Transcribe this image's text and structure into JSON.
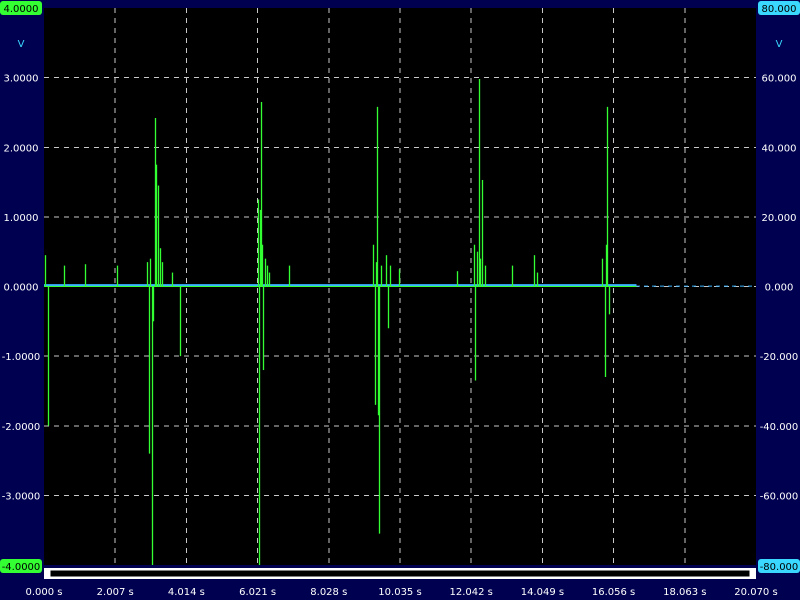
{
  "colors": {
    "background": "#000050",
    "plot_background": "#000000",
    "grid": "#c8c8c8",
    "channel_a": "#33ff33",
    "channel_b": "#3ab4ff",
    "badge_a": "#33ff33",
    "badge_b": "#3ad8ff"
  },
  "chart_data": {
    "type": "line",
    "grid": true,
    "left_axis": {
      "unit": "V",
      "ylim": [
        -4,
        4
      ],
      "top_label": "4.0000",
      "bottom_label": "-4.0000",
      "ticks": [
        "3.0000",
        "2.0000",
        "1.0000",
        "0.0000",
        "-1.0000",
        "-2.0000",
        "-3.0000"
      ],
      "tick_values": [
        3,
        2,
        1,
        0,
        -1,
        -2,
        -3
      ]
    },
    "right_axis": {
      "unit": "V",
      "ylim": [
        -80,
        80
      ],
      "top_label": "80.000",
      "bottom_label": "-80.000",
      "ticks": [
        "60.000",
        "40.000",
        "20.000",
        "0.000",
        "-20.000",
        "-40.000",
        "-60.000"
      ],
      "tick_values": [
        60,
        40,
        20,
        0,
        -20,
        -40,
        -60
      ]
    },
    "x_axis": {
      "xlim": [
        0,
        20.07
      ],
      "ticks": [
        "0.000 s",
        "2.007 s",
        "4.014 s",
        "6.021 s",
        "8.028 s",
        "10.035 s",
        "12.042 s",
        "14.049 s",
        "16.056 s",
        "18.063 s",
        "20.070 s"
      ],
      "tick_values": [
        0,
        2.007,
        4.014,
        6.021,
        8.028,
        10.035,
        12.042,
        14.049,
        16.056,
        18.063,
        20.07
      ]
    },
    "series": [
      {
        "axis": "left",
        "spikes": [
          {
            "t": 0.03,
            "v": 0.45
          },
          {
            "t": 0.1,
            "v": -2.0
          },
          {
            "t": 0.55,
            "v": 0.3
          },
          {
            "t": 1.15,
            "v": 0.32
          },
          {
            "t": 2.07,
            "v": 0.3
          },
          {
            "t": 2.9,
            "v": 0.35
          },
          {
            "t": 2.96,
            "v": -2.4
          },
          {
            "t": 3.0,
            "v": 0.4
          },
          {
            "t": 3.05,
            "v": -4.0
          },
          {
            "t": 3.08,
            "v": -0.5
          },
          {
            "t": 3.12,
            "v": 2.42
          },
          {
            "t": 3.16,
            "v": 1.75
          },
          {
            "t": 3.2,
            "v": 1.45
          },
          {
            "t": 3.26,
            "v": 0.55
          },
          {
            "t": 3.32,
            "v": 0.35
          },
          {
            "t": 3.6,
            "v": 0.2
          },
          {
            "t": 3.82,
            "v": -1.0
          },
          {
            "t": 6.02,
            "v": 1.25
          },
          {
            "t": 6.05,
            "v": -4.0
          },
          {
            "t": 6.08,
            "v": 1.1
          },
          {
            "t": 6.12,
            "v": 2.65
          },
          {
            "t": 6.15,
            "v": 0.6
          },
          {
            "t": 6.18,
            "v": -1.2
          },
          {
            "t": 6.22,
            "v": 0.4
          },
          {
            "t": 6.28,
            "v": 0.3
          },
          {
            "t": 6.35,
            "v": 0.2
          },
          {
            "t": 6.9,
            "v": 0.3
          },
          {
            "t": 9.28,
            "v": 0.6
          },
          {
            "t": 9.33,
            "v": -1.7
          },
          {
            "t": 9.36,
            "v": 0.35
          },
          {
            "t": 9.39,
            "v": 2.58
          },
          {
            "t": 9.42,
            "v": -1.85
          },
          {
            "t": 9.45,
            "v": -3.55
          },
          {
            "t": 9.5,
            "v": 0.3
          },
          {
            "t": 9.64,
            "v": 0.45
          },
          {
            "t": 9.7,
            "v": -0.6
          },
          {
            "t": 9.76,
            "v": 0.3
          },
          {
            "t": 10.0,
            "v": 0.25
          },
          {
            "t": 11.64,
            "v": 0.22
          },
          {
            "t": 12.12,
            "v": 0.6
          },
          {
            "t": 12.16,
            "v": -1.35
          },
          {
            "t": 12.2,
            "v": 0.5
          },
          {
            "t": 12.25,
            "v": 2.98
          },
          {
            "t": 12.3,
            "v": 0.4
          },
          {
            "t": 12.36,
            "v": 1.53
          },
          {
            "t": 12.42,
            "v": 0.3
          },
          {
            "t": 13.2,
            "v": 0.3
          },
          {
            "t": 13.8,
            "v": 0.45
          },
          {
            "t": 13.9,
            "v": 0.2
          },
          {
            "t": 15.74,
            "v": 0.4
          },
          {
            "t": 15.8,
            "v": -1.3
          },
          {
            "t": 15.84,
            "v": 0.6
          },
          {
            "t": 15.88,
            "v": 2.58
          },
          {
            "t": 15.92,
            "v": -0.4
          }
        ]
      },
      {
        "axis": "left",
        "trace_end": 16.7,
        "level": 0.02
      }
    ]
  }
}
